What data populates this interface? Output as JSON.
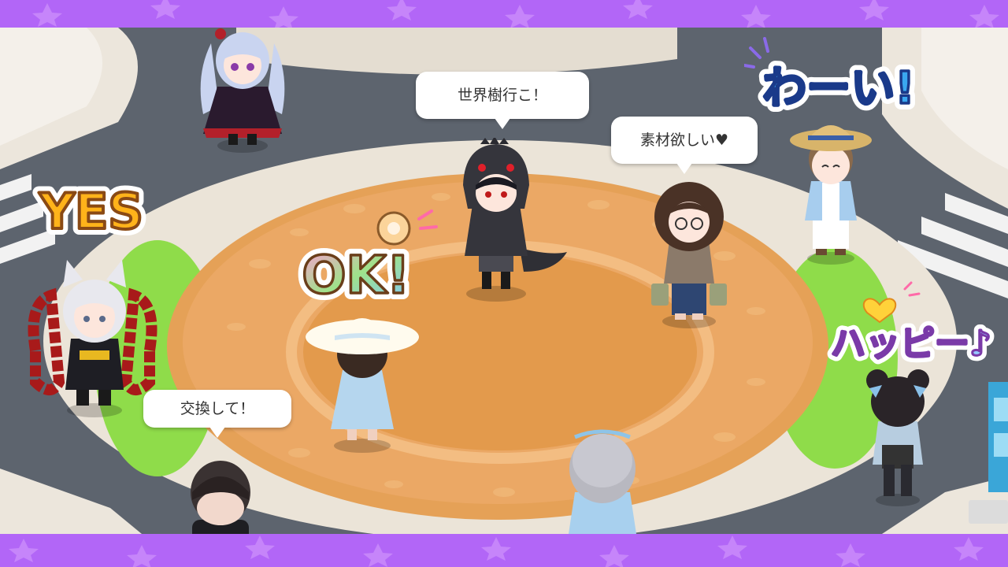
{
  "colors": {
    "frame": "#b266f7",
    "road": "#5d646e",
    "sidewalk": "#ece6dc",
    "plaza": "#e8a35c",
    "grass": "#8fdc4a"
  },
  "speech_bubbles": [
    {
      "id": "b1",
      "text": "世界樹行こ！"
    },
    {
      "id": "b2",
      "text": "素材欲しい♥"
    },
    {
      "id": "b3",
      "text": "交換して！"
    }
  ],
  "stickers": {
    "yes": "YES",
    "ok": "OK!",
    "waai": "わーい!",
    "happy": "ハッピー♪"
  },
  "avatars": [
    {
      "id": "gothic-lolita-girl",
      "hair_color": "#c9d4f0"
    },
    {
      "id": "dino-hoodie-boy",
      "hair_color": "#2a2a35"
    },
    {
      "id": "curly-hair-glasses",
      "hair_color": "#4a3226"
    },
    {
      "id": "straw-hat-boy",
      "hair_color": "#8a6a4c"
    },
    {
      "id": "fox-eared-boy",
      "hair_color": "#e8e8ee"
    },
    {
      "id": "sunhat-girl",
      "hair_color": "#3a2a22"
    },
    {
      "id": "bun-hair-girl",
      "hair_color": "#2a2428"
    },
    {
      "id": "short-hair-boy",
      "hair_color": "#3a3232"
    },
    {
      "id": "silver-hair-girl",
      "hair_color": "#b8b8c0"
    }
  ]
}
